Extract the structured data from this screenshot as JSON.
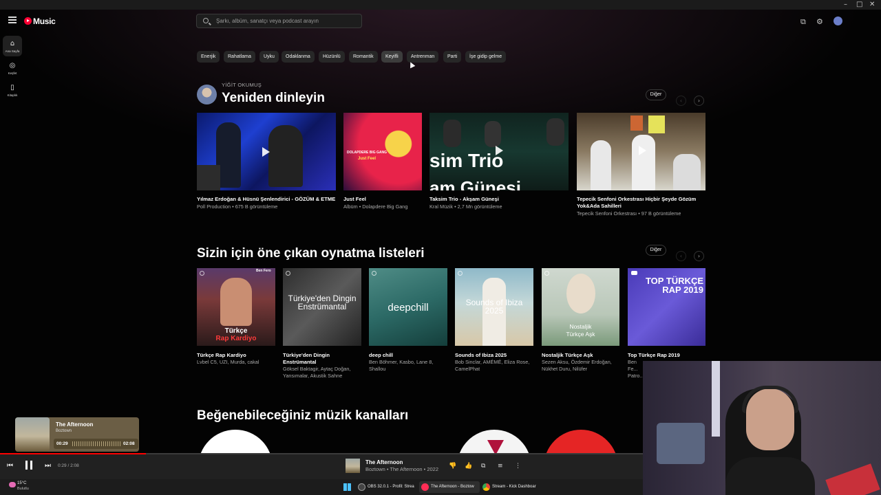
{
  "app": {
    "logo": "Music"
  },
  "search": {
    "placeholder": "Şarkı, albüm, sanatçı veya podcast arayın"
  },
  "sidebar": {
    "items": [
      {
        "label": "Ana Sayfa",
        "icon": "home-icon",
        "active": true
      },
      {
        "label": "Keşfet",
        "icon": "explore-icon",
        "active": false
      },
      {
        "label": "Kitaplık",
        "icon": "library-icon",
        "active": false
      }
    ]
  },
  "chips": [
    "Enerjik",
    "Rahatlama",
    "Uyku",
    "Odaklanma",
    "Hüzünlü",
    "Romantik",
    "Keyifli",
    "Antrenman",
    "Parti",
    "İşe gidip gelme"
  ],
  "listen_again": {
    "kicker": "YİĞİT OKUMUŞ",
    "title": "Yeniden dinleyin",
    "more": "Diğer",
    "cards": [
      {
        "title": "Yılmaz Erdoğan & Hüsnü Şenlendirici - GÖZÜM & ETME",
        "sub": "Poll Production • 675 B görüntüleme"
      },
      {
        "title": "Just Feel",
        "sub": "Albüm • Dolapdere Big Gang",
        "art_text": "DOLAPDERE BIG GANG",
        "art_text2": "Just Feel"
      },
      {
        "title": "Taksim Trio - Akşam Güneşi",
        "sub": "Kral Müzik • 2,7 Mn görüntüleme",
        "art_text": "sim Trio",
        "art_text2": "am Güneşi"
      },
      {
        "title": "Tepecik Senfoni Orkestrası Hiçbir Şeyde Gözüm Yok&Ada Sahilleri",
        "sub": "Tepecik Senfoni Orkestrası • 97 B görüntüleme"
      }
    ]
  },
  "playlists": {
    "title": "Sizin için öne çıkan oynatma listeleri",
    "more": "Diğer",
    "cards": [
      {
        "title": "Türkçe Rap Kardiyo",
        "sub": "Lvbel C5, UZI, Murda, cakal",
        "art_text": "Türkçe",
        "art_text2": "Rap Kardiyo",
        "corner": "Ben Fero"
      },
      {
        "title": "Türkiye'den Dingin Enstrümantal",
        "sub": "Göksel Baktagir, Aytaç Doğan, Yansımalar, Akustik Sahne",
        "art_text": "Türkiye'den Dingin Enstrümantal"
      },
      {
        "title": "deep chill",
        "sub": "Ben Böhmer, Kasbo, Lane 8, Shallou",
        "art_text": "deepchill"
      },
      {
        "title": "Sounds of Ibiza 2025",
        "sub": "Bob Sinclar, AMÉMÉ, Eliza Rose, CamelPhat",
        "art_text": "Sounds of Ibiza 2025"
      },
      {
        "title": "Nostaljik Türkçe Aşk",
        "sub": "Sezen Aksu, Özdemir Erdoğan, Nükhet Duru, Nilüfer",
        "art_text": "Nostaljik",
        "art_text2": "Türkçe Aşk"
      },
      {
        "title": "Top Türkçe Rap 2019",
        "sub": "Ben Fe... Patro...",
        "art_text": "TOP TÜRKÇE RAP 2019"
      }
    ]
  },
  "channels": {
    "title": "Beğenebileceğiniz müzik kanalları"
  },
  "mini_player": {
    "title": "The Afternoon",
    "artist": "Boztown",
    "elapsed": "00:29",
    "total": "02:08"
  },
  "player": {
    "time": "0:29 / 2:08",
    "progress": 0.227,
    "title": "The Afternoon",
    "subtitle": "Boztown • The Afternoon • 2022"
  },
  "taskbar": {
    "weather_temp": "15°C",
    "weather_desc": "Bulutlu",
    "tasks": [
      {
        "label": "OBS 32.0.1 - Profil: Strea",
        "icon_color": "#444444",
        "active": false
      },
      {
        "label": "The Afternoon - Boztow",
        "icon_color": "#ff2d55",
        "active": true
      },
      {
        "label": "Stream - Kick Dashboar",
        "icon_color": "#4285f4",
        "active": false
      }
    ]
  },
  "colors": {
    "accent": "#ff0000",
    "background": "#030303"
  }
}
